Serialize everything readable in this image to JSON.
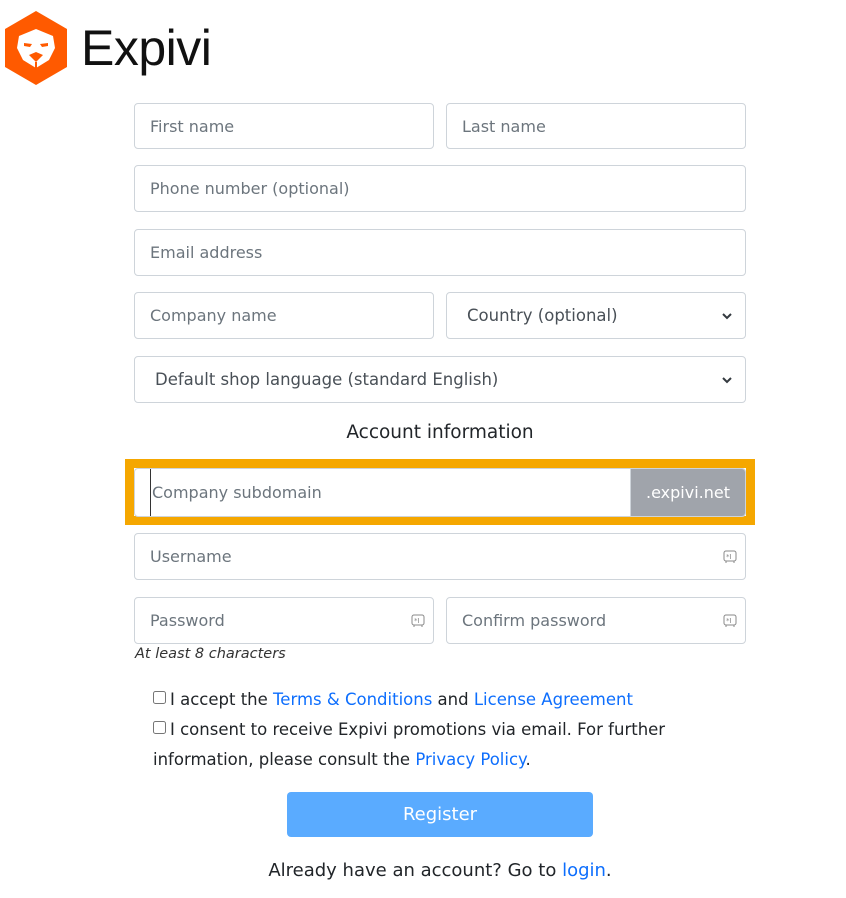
{
  "brand": {
    "name": "Expivi",
    "color": "#ff5a00"
  },
  "form": {
    "first_name": {
      "placeholder": "First name",
      "value": ""
    },
    "last_name": {
      "placeholder": "Last name",
      "value": ""
    },
    "phone": {
      "placeholder": "Phone number (optional)",
      "value": ""
    },
    "email": {
      "placeholder": "Email address",
      "value": ""
    },
    "company": {
      "placeholder": "Company name",
      "value": ""
    },
    "country": {
      "selected": "Country (optional)"
    },
    "language": {
      "selected": "Default shop language (standard English)"
    },
    "account_heading": "Account information",
    "subdomain": {
      "placeholder": "Company subdomain",
      "value": "",
      "suffix": ".expivi.net",
      "highlight_color": "#f5a700"
    },
    "username": {
      "placeholder": "Username",
      "value": ""
    },
    "password": {
      "placeholder": "Password",
      "value": ""
    },
    "confirm_password": {
      "placeholder": "Confirm password",
      "value": ""
    },
    "password_hint": "At least 8 characters",
    "terms": {
      "prefix": "I accept the ",
      "link1": "Terms & Conditions",
      "middle": " and ",
      "link2": "License Agreement",
      "checked": false
    },
    "consent": {
      "text": "I consent to receive Expivi promotions via email. For further information, please consult the ",
      "link": "Privacy Policy",
      "suffix": ".",
      "checked": false
    },
    "register_label": "Register",
    "login_prefix": "Already have an account? Go to ",
    "login_link": "login",
    "login_suffix": "."
  }
}
